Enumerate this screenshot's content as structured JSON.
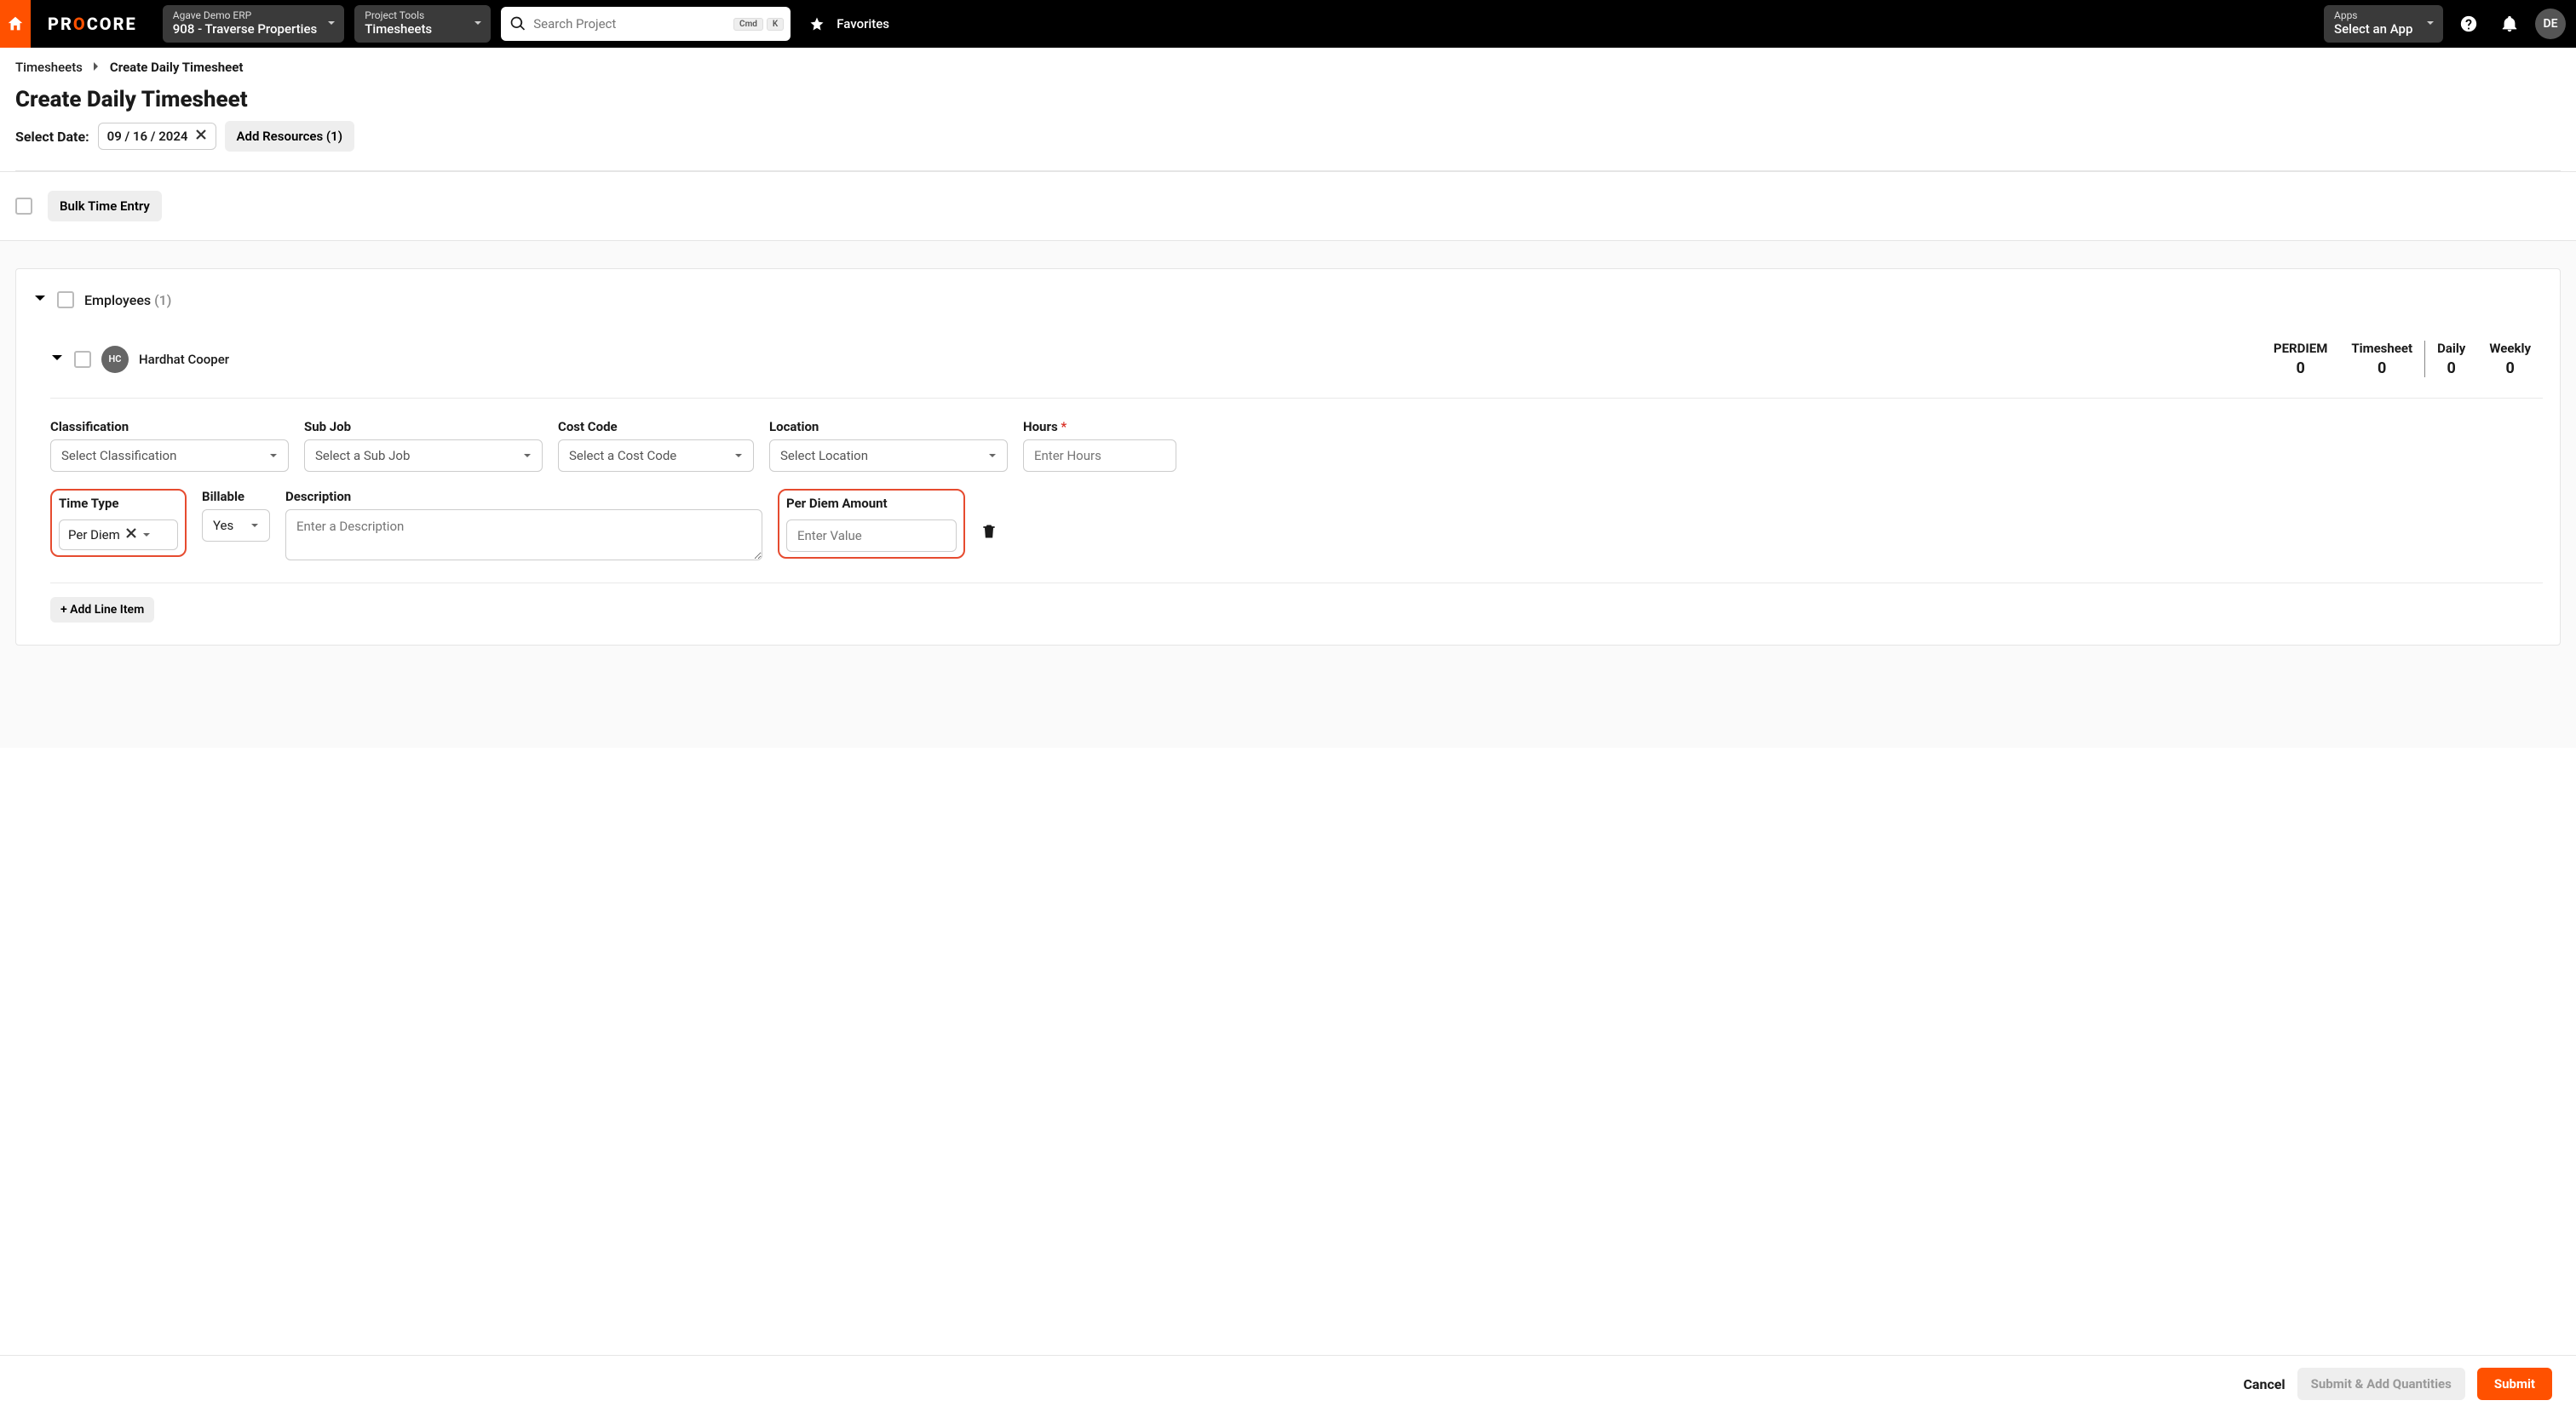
{
  "topbar": {
    "logo_text": "PROCORE",
    "erp": {
      "label": "Agave Demo ERP",
      "value": "908 - Traverse Properties"
    },
    "tools": {
      "label": "Project Tools",
      "value": "Timesheets"
    },
    "search_placeholder": "Search Project",
    "kbd1": "Cmd",
    "kbd2": "K",
    "favorites_label": "Favorites",
    "apps": {
      "label": "Apps",
      "value": "Select an App"
    },
    "avatar_initials": "DE"
  },
  "breadcrumb": {
    "root": "Timesheets",
    "current": "Create Daily Timesheet"
  },
  "page_title": "Create Daily Timesheet",
  "date_row": {
    "label": "Select Date:",
    "value": "09 / 16 / 2024",
    "add_resources_label": "Add Resources (1)"
  },
  "bulk_button_label": "Bulk Time Entry",
  "employees_section": {
    "label": "Employees",
    "count_suffix": "(1)"
  },
  "employee": {
    "initials": "HC",
    "name": "Hardhat Cooper",
    "stats": {
      "perdiem_label": "PERDIEM",
      "perdiem_value": "0",
      "timesheet_label": "Timesheet",
      "timesheet_value": "0",
      "daily_label": "Daily",
      "daily_value": "0",
      "weekly_label": "Weekly",
      "weekly_value": "0"
    }
  },
  "fields": {
    "classification": {
      "label": "Classification",
      "placeholder": "Select Classification"
    },
    "subjob": {
      "label": "Sub Job",
      "placeholder": "Select a Sub Job"
    },
    "costcode": {
      "label": "Cost Code",
      "placeholder": "Select a Cost Code"
    },
    "location": {
      "label": "Location",
      "placeholder": "Select Location"
    },
    "hours": {
      "label": "Hours",
      "placeholder": "Enter Hours"
    },
    "timetype": {
      "label": "Time Type",
      "value": "Per Diem"
    },
    "billable": {
      "label": "Billable",
      "value": "Yes"
    },
    "description": {
      "label": "Description",
      "placeholder": "Enter a Description"
    },
    "perdiem": {
      "label": "Per Diem Amount",
      "placeholder": "Enter Value"
    }
  },
  "add_line_item_label": "+ Add Line Item",
  "footer": {
    "cancel": "Cancel",
    "submit_add": "Submit & Add Quantities",
    "submit": "Submit"
  }
}
